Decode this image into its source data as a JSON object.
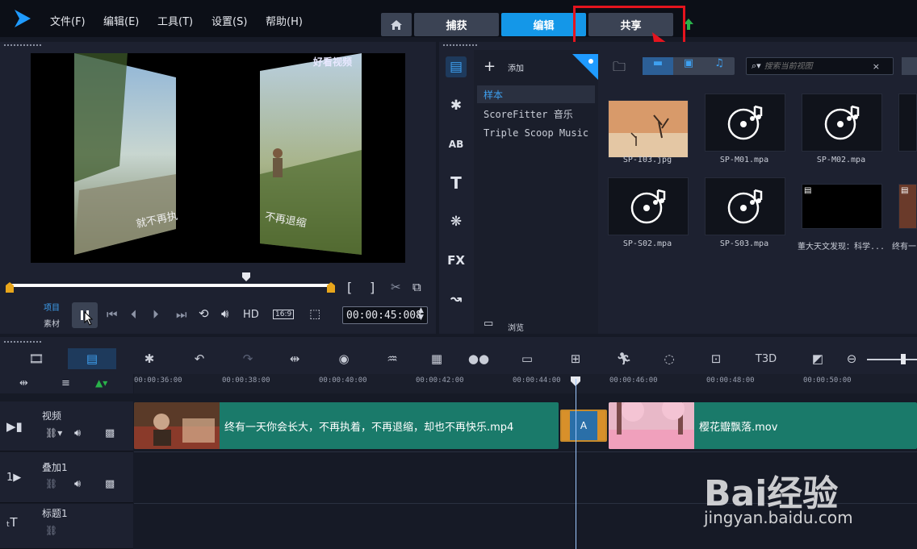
{
  "menu": {
    "file": "文件(F)",
    "edit": "编辑(E)",
    "tools": "工具(T)",
    "settings": "设置(S)",
    "help": "帮助(H)"
  },
  "tabs": {
    "capture": "捕获",
    "edit": "编辑",
    "share": "共享"
  },
  "preview": {
    "overlay_logo_text": "好看视频",
    "left_text": "就不再执",
    "right_text": "不再退缩",
    "project_label": "项目",
    "clip_label": "素材",
    "hd": "HD",
    "aspect": "16:9",
    "timecode": "00:00:45:008",
    "tooltip": "暂停"
  },
  "library": {
    "add_label": "添加",
    "items": [
      "样本",
      "ScoreFitter 音乐",
      "Triple Scoop Music"
    ],
    "browse_label": "浏览",
    "search_placeholder": "搜索当前视图",
    "media": [
      {
        "name": "SP-I03.jpg",
        "kind": "image"
      },
      {
        "name": "SP-M01.mpa",
        "kind": "audio"
      },
      {
        "name": "SP-M02.mpa",
        "kind": "audio"
      },
      {
        "name": "SP-S02.mpa",
        "kind": "audio"
      },
      {
        "name": "SP-S03.mpa",
        "kind": "audio"
      },
      {
        "name": "董大天文发现：科学...",
        "kind": "video"
      },
      {
        "name": "终有一",
        "kind": "video"
      }
    ]
  },
  "ruler": [
    "00:00:36:00",
    "00:00:38:00",
    "00:00:40:00",
    "00:00:42:00",
    "00:00:44:00",
    "00:00:46:00",
    "00:00:48:00",
    "00:00:50:00"
  ],
  "tracks": [
    {
      "name": "视频"
    },
    {
      "name": "叠加1"
    },
    {
      "name": "标题1"
    }
  ],
  "clips": {
    "clip1": "终有一天你会长大，不再执着，不再退缩，却也不再快乐.mp4",
    "clip2": "樱花瓣飘落.mov"
  },
  "watermark": {
    "brand": "Bai经验",
    "url": "jingyan.baidu.com"
  },
  "colors": {
    "accent": "#1497e8",
    "highlight": "#e5141e",
    "clip": "#1a7a6a"
  }
}
